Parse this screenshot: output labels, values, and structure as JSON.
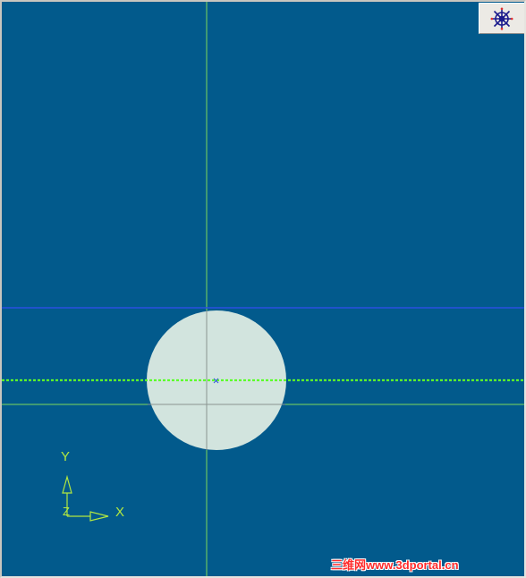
{
  "viewport": {
    "background_color": "#025a8c",
    "construction_line_color": "#7fd85a",
    "highlight_line_color": "#2a4fe0",
    "dashed_centerline_color": "#5cff2a",
    "circle_fill_color": "#d2e4de",
    "center_marker_color": "#3355dd"
  },
  "nav_button": {
    "icon": "ship-wheel-icon"
  },
  "axis_triad": {
    "y_label": "Y",
    "x_label": "X",
    "z_label": "Z",
    "color": "#b2e840"
  },
  "watermark": {
    "text": "三维网www.3dportal.cn",
    "color": "#ff2b2b"
  }
}
